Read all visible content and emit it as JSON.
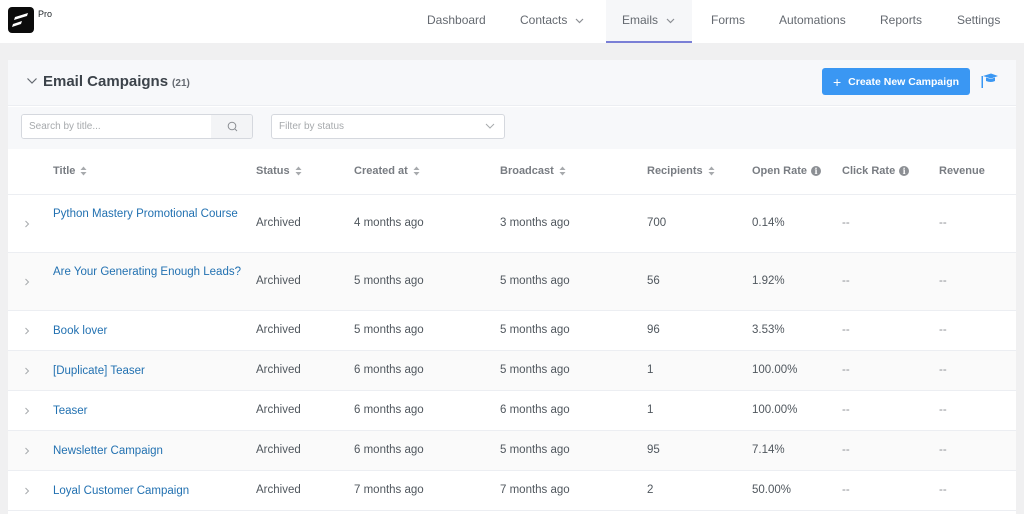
{
  "app": {
    "badge": "Pro"
  },
  "nav": {
    "items": [
      {
        "label": "Dashboard",
        "has_dropdown": false,
        "active": false
      },
      {
        "label": "Contacts",
        "has_dropdown": true,
        "active": false
      },
      {
        "label": "Emails",
        "has_dropdown": true,
        "active": true
      },
      {
        "label": "Forms",
        "has_dropdown": false,
        "active": false
      },
      {
        "label": "Automations",
        "has_dropdown": false,
        "active": false
      },
      {
        "label": "Reports",
        "has_dropdown": false,
        "active": false
      },
      {
        "label": "Settings",
        "has_dropdown": false,
        "active": false
      }
    ]
  },
  "page": {
    "title": "Email Campaigns",
    "count": "(21)",
    "create_button": "Create New Campaign",
    "accent_color": "#3a97f3",
    "link_color": "#2271b1"
  },
  "filters": {
    "search_placeholder": "Search by title...",
    "search_value": "",
    "status_placeholder": "Filter by status"
  },
  "table": {
    "columns": [
      {
        "label": "Title",
        "sortable": true,
        "info": false
      },
      {
        "label": "Status",
        "sortable": true,
        "info": false
      },
      {
        "label": "Created at",
        "sortable": true,
        "info": false
      },
      {
        "label": "Broadcast",
        "sortable": true,
        "info": false
      },
      {
        "label": "Recipients",
        "sortable": true,
        "info": false
      },
      {
        "label": "Open Rate",
        "sortable": false,
        "info": true
      },
      {
        "label": "Click Rate",
        "sortable": false,
        "info": true
      },
      {
        "label": "Revenue",
        "sortable": false,
        "info": false
      }
    ],
    "rows": [
      {
        "title": "Python Mastery Promotional Course",
        "status": "Archived",
        "created_at": "4 months ago",
        "broadcast": "3 months ago",
        "recipients": "700",
        "open_rate": "0.14%",
        "click_rate": "--",
        "revenue": "--"
      },
      {
        "title": "Are Your Generating Enough Leads?",
        "status": "Archived",
        "created_at": "5 months ago",
        "broadcast": "5 months ago",
        "recipients": "56",
        "open_rate": "1.92%",
        "click_rate": "--",
        "revenue": "--"
      },
      {
        "title": "Book lover",
        "status": "Archived",
        "created_at": "5 months ago",
        "broadcast": "5 months ago",
        "recipients": "96",
        "open_rate": "3.53%",
        "click_rate": "--",
        "revenue": "--"
      },
      {
        "title": "[Duplicate] Teaser",
        "status": "Archived",
        "created_at": "6 months ago",
        "broadcast": "5 months ago",
        "recipients": "1",
        "open_rate": "100.00%",
        "click_rate": "--",
        "revenue": "--"
      },
      {
        "title": "Teaser",
        "status": "Archived",
        "created_at": "6 months ago",
        "broadcast": "6 months ago",
        "recipients": "1",
        "open_rate": "100.00%",
        "click_rate": "--",
        "revenue": "--"
      },
      {
        "title": "Newsletter Campaign",
        "status": "Archived",
        "created_at": "6 months ago",
        "broadcast": "5 months ago",
        "recipients": "95",
        "open_rate": "7.14%",
        "click_rate": "--",
        "revenue": "--"
      },
      {
        "title": "Loyal Customer Campaign",
        "status": "Archived",
        "created_at": "7 months ago",
        "broadcast": "7 months ago",
        "recipients": "2",
        "open_rate": "50.00%",
        "click_rate": "--",
        "revenue": "--"
      }
    ]
  }
}
